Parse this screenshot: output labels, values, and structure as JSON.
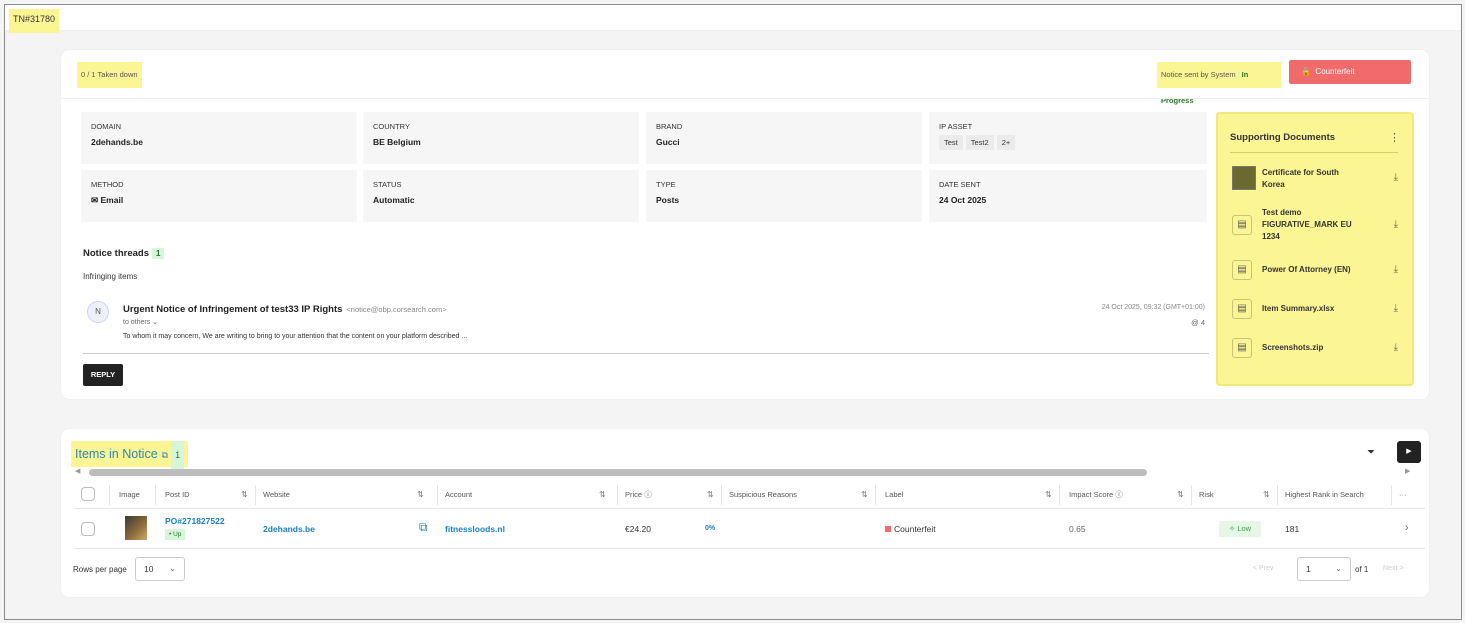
{
  "ticket_id": "TN#31780",
  "header": {
    "taken_down": "0 / 1 Taken down",
    "notice_sent": "Notice sent by System",
    "status_progress": "In Progress",
    "counterfeit_button": "Counterfeit",
    "lock_icon": "lock-icon"
  },
  "details": [
    {
      "label": "DOMAIN",
      "value": "2dehands.be"
    },
    {
      "label": "COUNTRY",
      "value": "BE Belgium"
    },
    {
      "label": "BRAND",
      "value": "Gucci"
    },
    {
      "label": "IP ASSET",
      "tags": [
        "Test",
        "Test2",
        "2+"
      ]
    },
    {
      "label": "METHOD",
      "value": "Email",
      "icon": "mail-icon"
    },
    {
      "label": "STATUS",
      "value": "Automatic"
    },
    {
      "label": "TYPE",
      "value": "Posts"
    },
    {
      "label": "DATE SENT",
      "value": "24 Oct 2025"
    }
  ],
  "docs": {
    "title": "Supporting Documents",
    "items": [
      {
        "name": "Certificate for South Korea"
      },
      {
        "name": "Test demo FIGURATIVE_MARK EU 1234"
      },
      {
        "name": "Power Of Attorney (EN)"
      },
      {
        "name": "Item Summary.xlsx"
      },
      {
        "name": "Screenshots.zip"
      }
    ]
  },
  "threads": {
    "title": "Notice threads",
    "count": "1",
    "infringing": "Infringing items",
    "avatar": "N",
    "subject": "Urgent Notice of Infringement of test33 IP Rights",
    "from": "<notice@obp.corsearch.com>",
    "to": "to others ⌄",
    "body": "To whom it may concern, We are writing to bring to your attention that the content on your platform described ...",
    "date": "24 Oct 2025, 09:32 (GMT+01:00)",
    "attachments": "@ 4",
    "reply": "REPLY"
  },
  "items": {
    "title": "Items in Notice",
    "count": "1",
    "columns": [
      "Image",
      "Post ID",
      "Website",
      "Account",
      "Price",
      "Suspicious Reasons",
      "Label",
      "Impact Score",
      "Risk",
      "Highest Rank in Search"
    ],
    "row": {
      "post_id": "PO#271827522",
      "up": "• Up",
      "website": "2dehands.be",
      "account": "fitnessloods.nl",
      "price": "€24.20",
      "price_pct": "0%",
      "label": "Counterfeit",
      "impact": "0.65",
      "risk": "Low",
      "rank": "181"
    },
    "rows_per_page_label": "Rows per page",
    "rows_per_page": "10",
    "prev": "< Prev",
    "page": "1",
    "of": "of 1",
    "next": "Next >",
    "more": "···"
  },
  "colors": {
    "highlight": "#fbf593",
    "counterfeit": "#f26b6b",
    "link": "#1a7fc1"
  }
}
